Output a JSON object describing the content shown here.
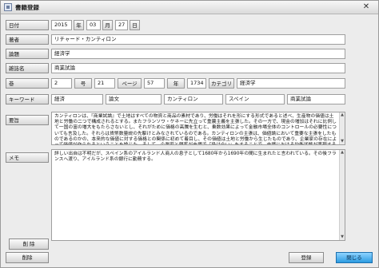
{
  "window": {
    "title": "書籍登録"
  },
  "date": {
    "label": "日付",
    "year": "2015",
    "year_unit": "年",
    "month": "03",
    "month_unit": "月",
    "day": "27",
    "day_unit": "日"
  },
  "author": {
    "label": "著者",
    "value": "リチャード・カンティロン"
  },
  "title": {
    "label": "論題",
    "value": "経済学"
  },
  "magazine": {
    "label": "雑誌名",
    "value": "商業試論"
  },
  "volume": {
    "label": "巻",
    "value": "2",
    "number_label": "号",
    "number": "21",
    "page_label": "ページ",
    "page": "57",
    "year_label": "年",
    "year": "1734",
    "category_label": "カテゴリ",
    "category": "経済学"
  },
  "keywords": {
    "label": "キーワード",
    "values": [
      "経済",
      "論文",
      "カンティロン",
      "スペイン",
      "商業試論"
    ]
  },
  "summary": {
    "label": "要旨",
    "text": "カンティロンは、『商業試論』で土地はすべての物資と商品の素材であり、労働はそれを形にする形式であると述べ、生産物の価値は土地と労働の二つで構成されるとする。またフランソワ・ケネーに先立って重農主義を主張した。その一方で、現金の増加はそれに比例して一国の富の増大をもたらさないとし、それがために価格の高騰を生むと、乗数効果によって金融市場全体のコントロールの必要性についても言及した。それらは貨幣数量説の先駆けとみなされているのである。カンティロンの主張は、価値論において重要な主張をしたものであるのかの、本来的な価値に対する価格との関係に初めて着目し、その価値は土地と労働から生じたものであり、企業家の存在によって価値が作られるということを論じた。そして、企業家と顧客が市場で『掛け合い』をすることで、市場における均衡状態が実現すると結論付けている。"
  },
  "memo": {
    "label": "メモ",
    "text": "詳しい出自は不明だが、スペイン系のアイルランド人商人の息子として1680年から1690年の間に生まれたと言われている。その後フランスへ渡り、アイルランド系の銀行に勤務する。"
  },
  "buttons": {
    "delete_label": "削 除",
    "delete2_label": "削除",
    "register_label": "登録",
    "close_label": "閉じる"
  }
}
